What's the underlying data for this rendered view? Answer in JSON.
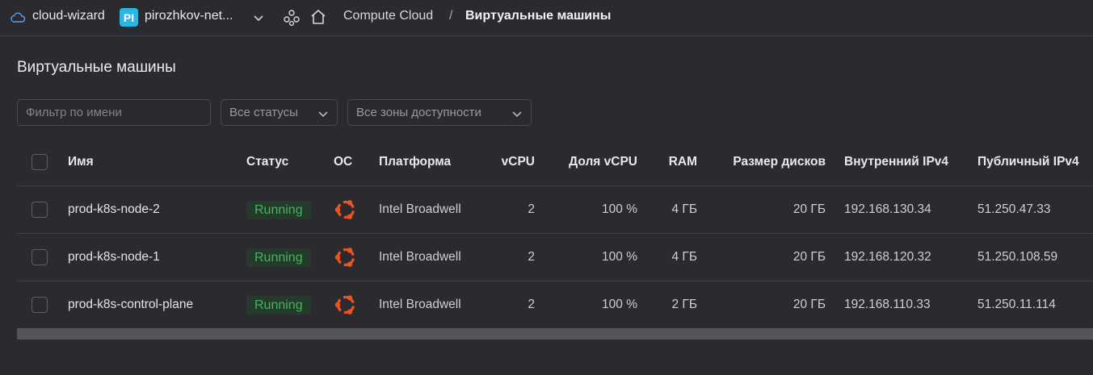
{
  "topbar": {
    "cloud_name": "cloud-wizard",
    "folder_badge": "PI",
    "folder_name": "pirozhkov-net...",
    "breadcrumb_service": "Compute Cloud",
    "breadcrumb_sep": "/",
    "breadcrumb_current": "Виртуальные машины"
  },
  "page": {
    "title": "Виртуальные машины"
  },
  "filters": {
    "name_placeholder": "Фильтр по имени",
    "status_select": "Все статусы",
    "zone_select": "Все зоны доступности"
  },
  "table": {
    "headers": {
      "name": "Имя",
      "status": "Статус",
      "os": "ОС",
      "platform": "Платформа",
      "vcpu": "vCPU",
      "vcpu_share": "Доля vCPU",
      "ram": "RAM",
      "disk": "Размер дисков",
      "ip_internal": "Внутренний IPv4",
      "ip_public": "Публичный IPv4"
    },
    "rows": [
      {
        "name": "prod-k8s-node-2",
        "status": "Running",
        "os_icon": "ubuntu-icon",
        "platform": "Intel Broadwell",
        "vcpu": "2",
        "vcpu_share": "100 %",
        "ram": "4 ГБ",
        "disk": "20 ГБ",
        "ip_internal": "192.168.130.34",
        "ip_public": "51.250.47.33"
      },
      {
        "name": "prod-k8s-node-1",
        "status": "Running",
        "os_icon": "ubuntu-icon",
        "platform": "Intel Broadwell",
        "vcpu": "2",
        "vcpu_share": "100 %",
        "ram": "4 ГБ",
        "disk": "20 ГБ",
        "ip_internal": "192.168.120.32",
        "ip_public": "51.250.108.59"
      },
      {
        "name": "prod-k8s-control-plane",
        "status": "Running",
        "os_icon": "ubuntu-icon",
        "platform": "Intel Broadwell",
        "vcpu": "2",
        "vcpu_share": "100 %",
        "ram": "2 ГБ",
        "disk": "20 ГБ",
        "ip_internal": "192.168.110.33",
        "ip_public": "51.250.11.114"
      }
    ]
  },
  "colors": {
    "background": "#2b2a2f",
    "running_text": "#45b458",
    "running_bg": "#243b2b",
    "ubuntu_orange": "#e95420",
    "folder_badge": "#29b6e6"
  }
}
